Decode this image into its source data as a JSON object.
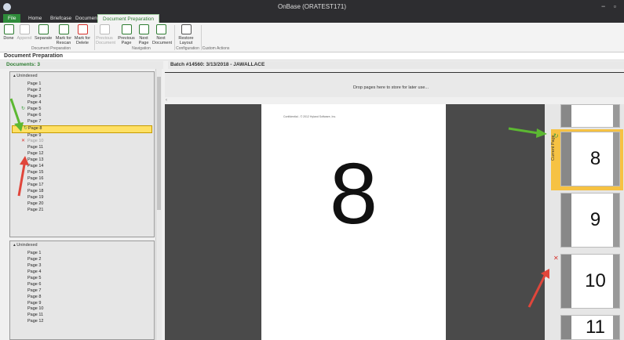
{
  "window": {
    "title": "OnBase (ORATEST171)",
    "controls": "− ▫"
  },
  "menu": {
    "tabs": [
      "File",
      "Home",
      "Briefcase",
      "Document",
      "Document Preparation"
    ]
  },
  "ribbon": {
    "buttons": [
      {
        "label": "Done",
        "enabled": true
      },
      {
        "label": "Append",
        "enabled": false
      },
      {
        "label": "Separate",
        "enabled": true
      },
      {
        "label": "Mark for Rescan",
        "enabled": true
      },
      {
        "label": "Mark for Delete",
        "enabled": true
      },
      {
        "label": "Previous Document",
        "enabled": false
      },
      {
        "label": "Previous Page",
        "enabled": true
      },
      {
        "label": "Next Page",
        "enabled": true
      },
      {
        "label": "Next Document",
        "enabled": true
      },
      {
        "label": "Restore Layout",
        "enabled": true
      }
    ],
    "groups": [
      "Document Preparation",
      "Navigation",
      "Configuration",
      "Custom Actions"
    ]
  },
  "section_title": "Document Preparation",
  "left": {
    "documents_count": "Documents: 3",
    "doc1": {
      "header": "Unindexed",
      "pages": [
        {
          "label": "Page 1"
        },
        {
          "label": "Page 2"
        },
        {
          "label": "Page 3"
        },
        {
          "label": "Page 4"
        },
        {
          "label": "Page 5",
          "mark": "rescan"
        },
        {
          "label": "Page 6"
        },
        {
          "label": "Page 7"
        },
        {
          "label": "Page 8",
          "mark": "rescan",
          "selected": true
        },
        {
          "label": "Page 9"
        },
        {
          "label": "Page 10",
          "mark": "delete"
        },
        {
          "label": "Page 11"
        },
        {
          "label": "Page 12"
        },
        {
          "label": "Page 13"
        },
        {
          "label": "Page 14"
        },
        {
          "label": "Page 15"
        },
        {
          "label": "Page 16"
        },
        {
          "label": "Page 17"
        },
        {
          "label": "Page 18"
        },
        {
          "label": "Page 19"
        },
        {
          "label": "Page 20"
        },
        {
          "label": "Page 21"
        }
      ]
    },
    "doc2": {
      "header": "Unindexed",
      "pages": [
        "Page 1",
        "Page 2",
        "Page 3",
        "Page 4",
        "Page 5",
        "Page 6",
        "Page 7",
        "Page 8",
        "Page 9",
        "Page 10",
        "Page 11",
        "Page 12"
      ]
    }
  },
  "batch_title": "Batch #14560: 3/13/2018 - JAWALLACE",
  "dropzone_text": "Drop pages here to store for later use...",
  "viewer": {
    "confidential": "Confidential - © 2012 Hyland Software, Inc.",
    "page_number": "8"
  },
  "thumbnails": {
    "current_label": "Current Page",
    "items": [
      {
        "num": ""
      },
      {
        "num": "8",
        "current": true,
        "mark": "rescan"
      },
      {
        "num": "9"
      },
      {
        "num": "10",
        "mark": "delete"
      },
      {
        "num": "11"
      }
    ]
  },
  "colors": {
    "accent_green": "#2e8b3a",
    "selection_yellow": "#ffe063",
    "delete_red": "#d6322c"
  }
}
